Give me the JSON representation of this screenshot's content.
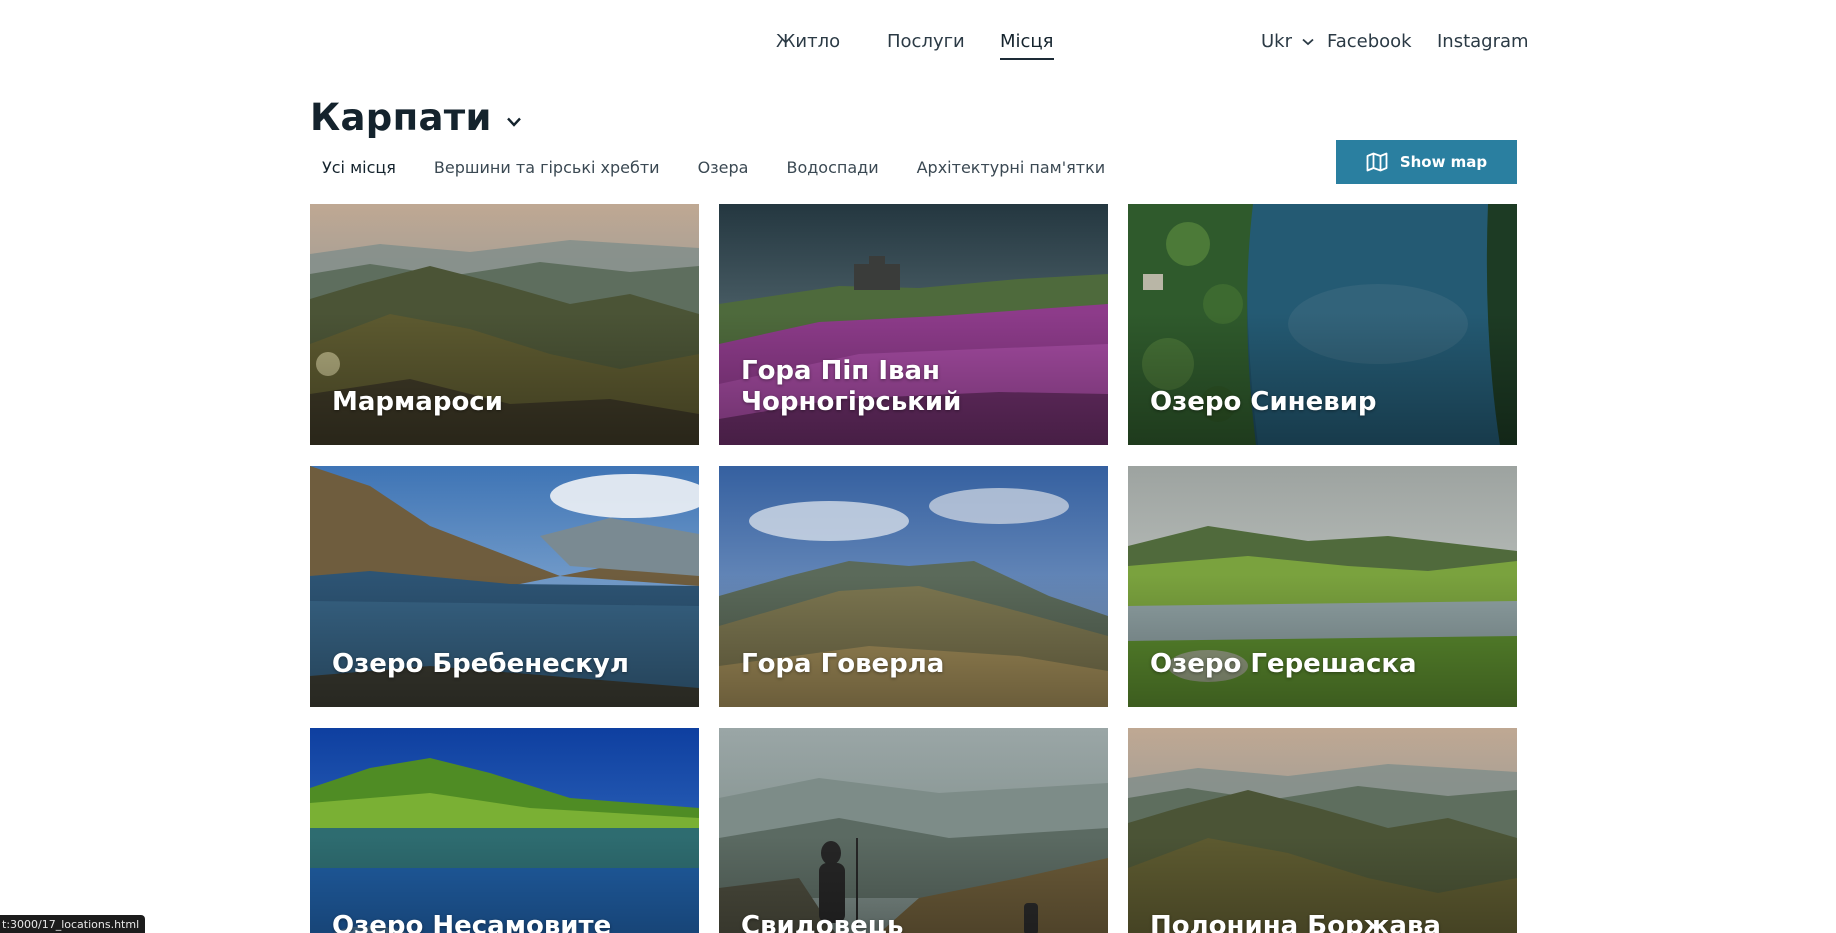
{
  "nav": {
    "links": [
      {
        "label": "Житло"
      },
      {
        "label": "Послуги"
      },
      {
        "label": "Місця",
        "active": true
      }
    ],
    "language": "Ukr",
    "social": [
      "Facebook",
      "Instagram"
    ]
  },
  "region": {
    "title": "Карпати"
  },
  "filters": [
    {
      "label": "Усі місця",
      "active": true
    },
    {
      "label": "Вершини та гірські хребти"
    },
    {
      "label": "Озера"
    },
    {
      "label": "Водоспади"
    },
    {
      "label": "Архітектурні пам'ятки"
    }
  ],
  "show_map": {
    "label": "Show map",
    "icon": "map-icon",
    "color": "#2a7fa0"
  },
  "places": [
    {
      "title": "Мармароси"
    },
    {
      "title": "Гора Піп Іван Чорногірський"
    },
    {
      "title": "Озеро Синевир"
    },
    {
      "title": "Озеро Бребенескул"
    },
    {
      "title": "Гора Говерла"
    },
    {
      "title": "Озеро Герешаска"
    },
    {
      "title": "Озеро Несамовите"
    },
    {
      "title": "Свидовець"
    },
    {
      "title": "Полонина Боржава"
    }
  ],
  "status_url": "t:3000/17_locations.html"
}
